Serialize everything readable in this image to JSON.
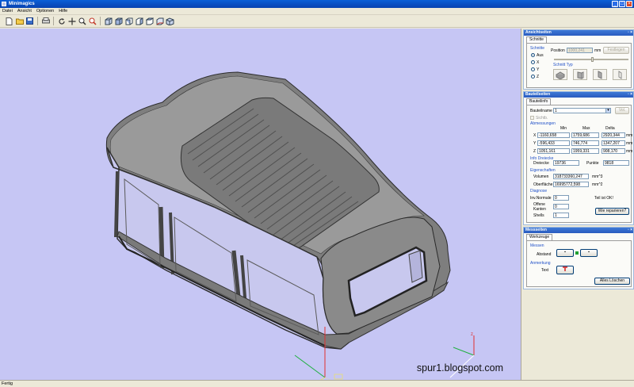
{
  "window": {
    "title": "Minimagics",
    "controls": [
      "_",
      "□",
      "×"
    ]
  },
  "menu": [
    "Datei",
    "Ansicht",
    "Optionen",
    "Hilfe"
  ],
  "toolbar": {
    "icons": [
      "new-icon",
      "open-icon",
      "save-icon",
      "print-icon",
      "rotate-icon",
      "pan-icon",
      "zoom-icon",
      "zoom-fit-icon",
      "view-front-icon",
      "view-back-icon",
      "view-left-icon",
      "view-right-icon",
      "view-top-icon",
      "view-bottom-icon",
      "view-iso-icon"
    ]
  },
  "watermark": "spur1.blogspot.com",
  "views_panel": {
    "title": "Ansichtseiten",
    "tab": "Schnitte",
    "group_schnitte": "Schnitte",
    "options": [
      "Aus",
      "X",
      "Y",
      "Z"
    ],
    "selected": "Aus",
    "position_label": "Position",
    "position_value": "1000,241",
    "unit": "mm",
    "fix_button": "Festlegen",
    "schnitt_typ": "Schnitt Typ"
  },
  "part_panel": {
    "title": "Bauteilseiten",
    "tab": "Bauteilinfo",
    "name_label": "Bauteilname",
    "name_value": "1",
    "vol_button": "Vol.",
    "checkbox_label": "Sichtb.",
    "dims_label": "Abmessungen",
    "col_headers": [
      "Min",
      "Max",
      "Delta"
    ],
    "rows": [
      {
        "axis": "X",
        "min": "-1160,658",
        "max": "1759,686",
        "delta": "2920,344",
        "unit": "mm"
      },
      {
        "axis": "Y",
        "min": "-596,433",
        "max": "746,774",
        "delta": "1347,207",
        "unit": "mm"
      },
      {
        "axis": "Z",
        "min": "1051,161",
        "max": "1959,331",
        "delta": "908,170",
        "unit": "mm"
      }
    ],
    "info_label": "Info Dreiecke",
    "dreiecke_label": "Dreiecke",
    "dreiecke_value": "19736",
    "punkte_label": "Punkte",
    "punkte_value": "9818",
    "eigen_label": "Eigenschaften",
    "volumen_label": "Volumen",
    "volumen_value": "318733360,247",
    "volumen_unit": "mm^3",
    "oberflaeche_label": "Oberfläche",
    "oberflaeche_value": "16995772,598",
    "oberflaeche_unit": "mm^2",
    "diagnose_label": "Diagnose",
    "normale_label": "Inv.Normale",
    "normale_value": "0",
    "offene_label_1": "Offene",
    "offene_label_2": "Kanten",
    "offene_value": "0",
    "shells_label": "Shells",
    "shells_value": "1",
    "status_text": "Teil ist OK!",
    "repair_button": "Wie reparieren?"
  },
  "measure_panel": {
    "title": "Messseiten",
    "tab": "Werkzeuge",
    "messen_label": "Messen",
    "abstand_label": "Abstand",
    "anmerkung_label": "Anmerkung",
    "text_label": "Text",
    "clear_button": "Alles Löschen"
  },
  "status": "Fertig"
}
